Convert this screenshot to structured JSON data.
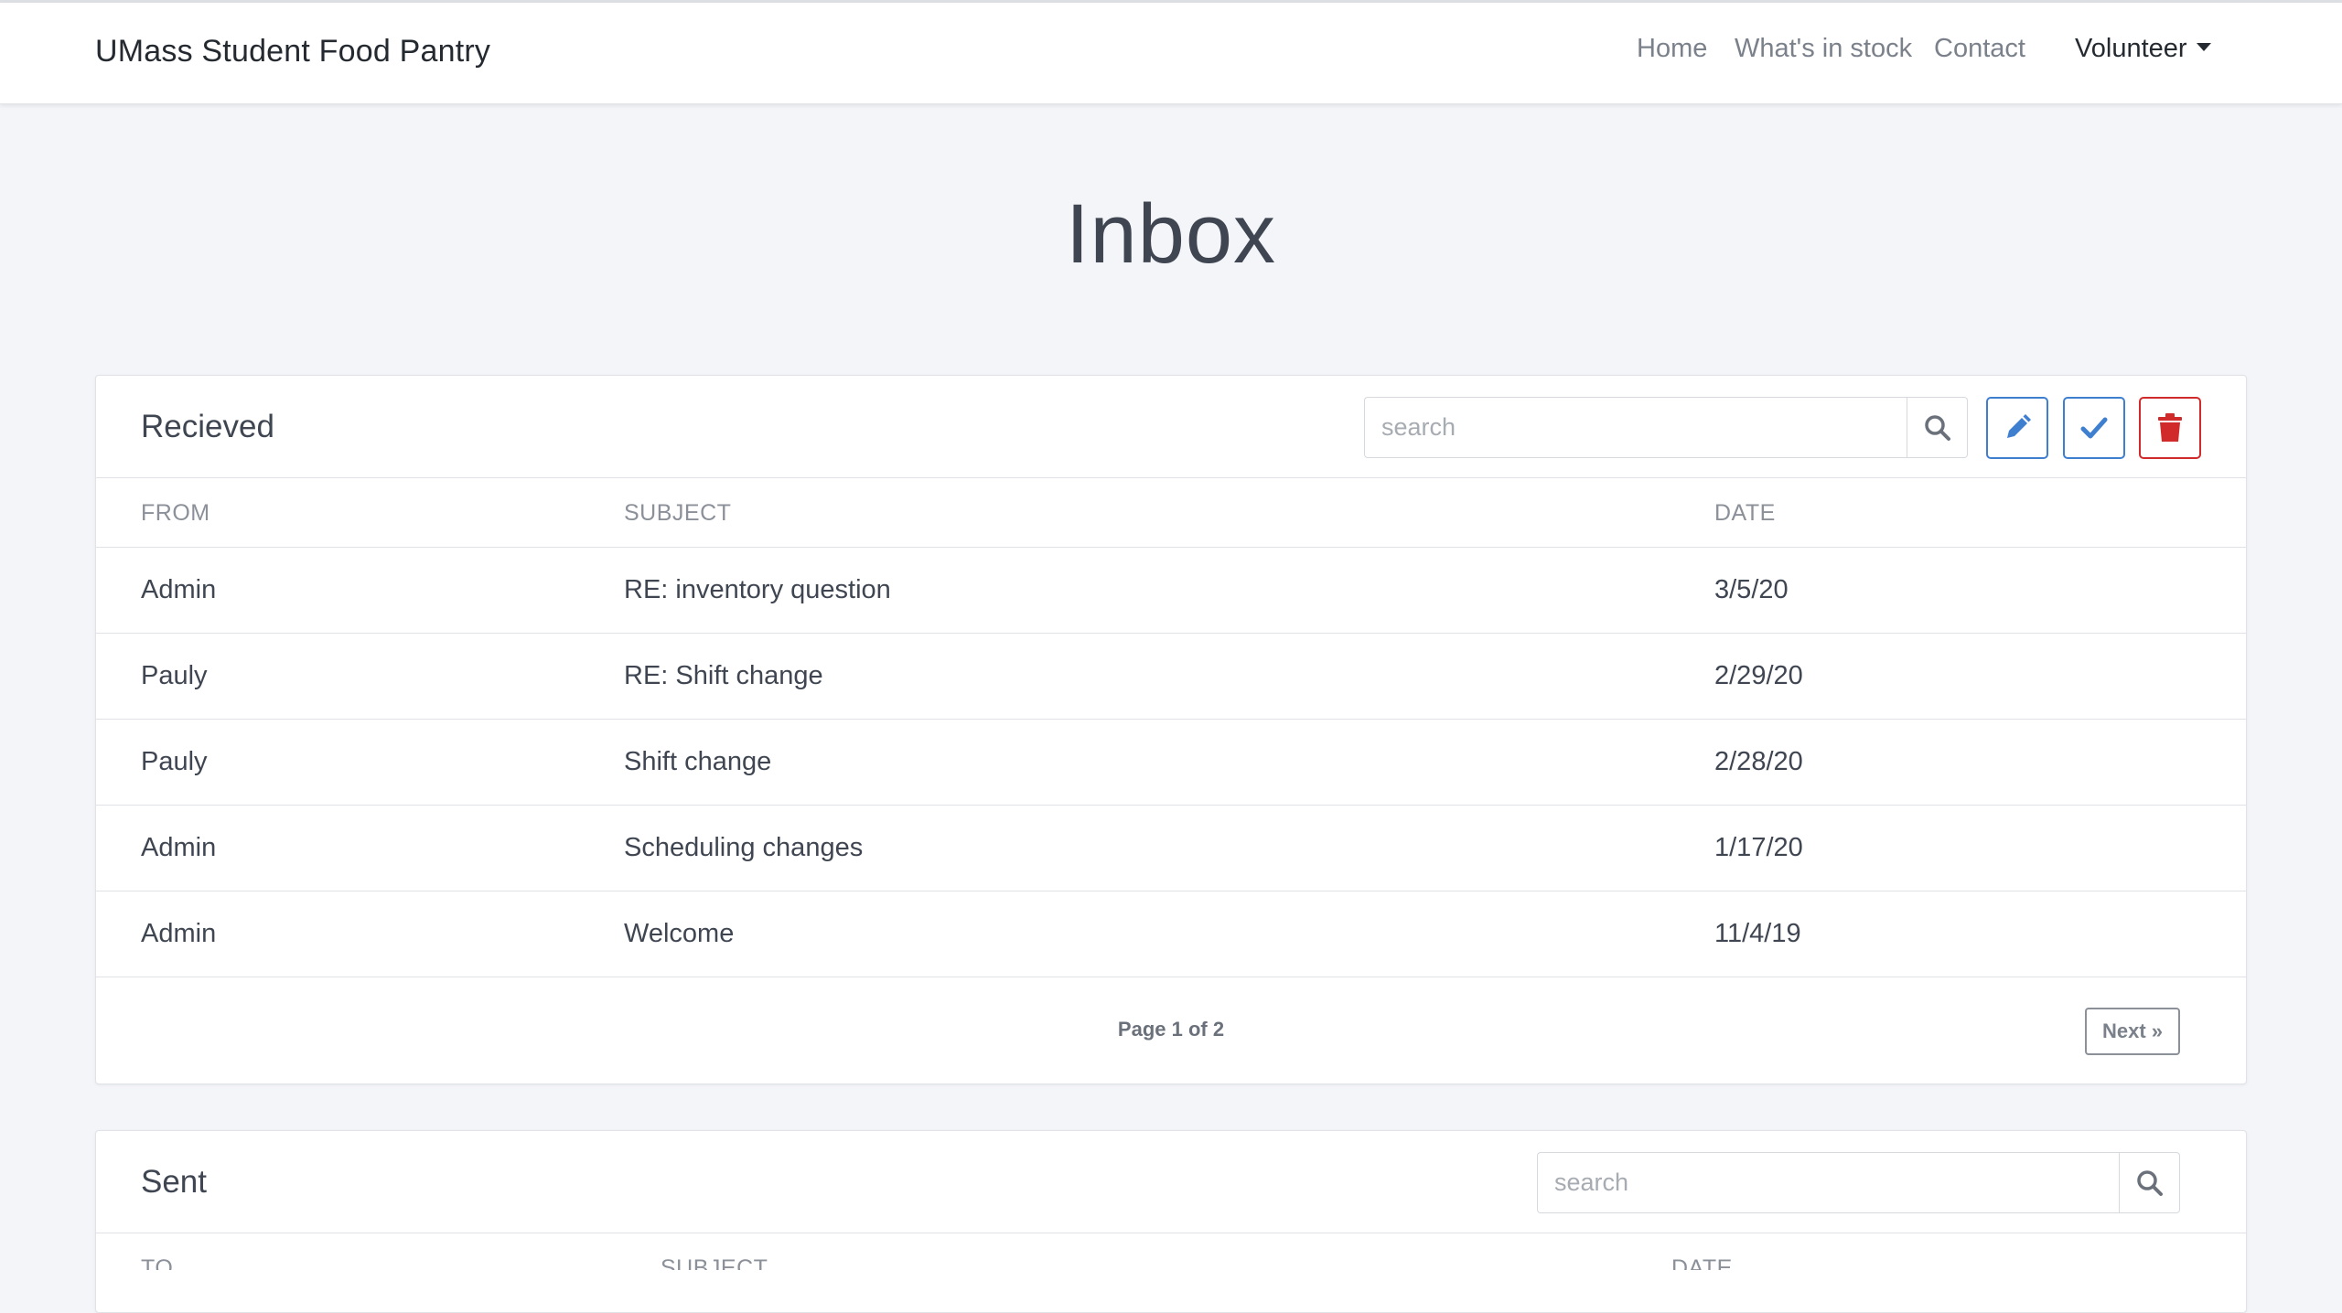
{
  "navbar": {
    "brand": "UMass Student Food Pantry",
    "links": [
      "Home",
      "What's in stock",
      "Contact"
    ],
    "dropdown_label": "Volunteer"
  },
  "page": {
    "title": "Inbox"
  },
  "received": {
    "title": "Recieved",
    "search_placeholder": "search",
    "columns": [
      "FROM",
      "SUBJECT",
      "DATE"
    ],
    "rows": [
      {
        "from": "Admin",
        "subject": "RE: inventory question",
        "date": "3/5/20"
      },
      {
        "from": "Pauly",
        "subject": "RE: Shift change",
        "date": "2/29/20"
      },
      {
        "from": "Pauly",
        "subject": "Shift change",
        "date": "2/28/20"
      },
      {
        "from": "Admin",
        "subject": "Scheduling changes",
        "date": "1/17/20"
      },
      {
        "from": "Admin",
        "subject": "Welcome",
        "date": "11/4/19"
      }
    ],
    "pagination": {
      "label": "Page 1 of 2",
      "next_label": "Next »"
    },
    "actions": {
      "edit_icon": "pencil-icon",
      "check_icon": "check-icon",
      "delete_icon": "trash-icon"
    }
  },
  "sent": {
    "title": "Sent",
    "search_placeholder": "search",
    "columns": [
      "TO",
      "SUBJECT",
      "DATE"
    ]
  },
  "colors": {
    "accent_blue": "#3f7fd0",
    "danger_red": "#d12a2a",
    "background": "#f4f5f8"
  }
}
